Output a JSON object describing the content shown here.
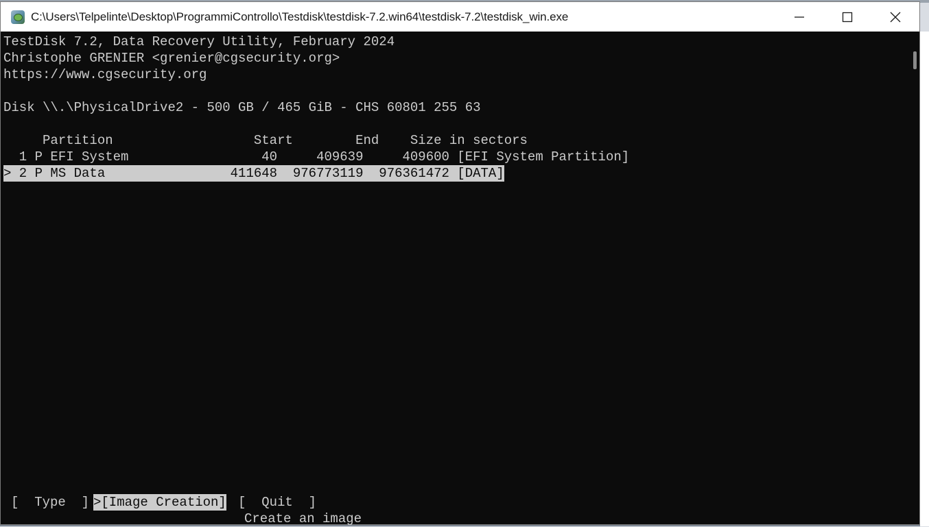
{
  "window": {
    "title": "C:\\Users\\Telpelinte\\Desktop\\ProgrammiControllo\\Testdisk\\testdisk-7.2.win64\\testdisk-7.2\\testdisk_win.exe",
    "app_icon": "testdisk-app-icon",
    "controls": {
      "minimize": "minimize-icon",
      "maximize": "maximize-icon",
      "close": "close-icon"
    }
  },
  "console": {
    "header": [
      "TestDisk 7.2, Data Recovery Utility, February 2024",
      "Christophe GRENIER <grenier@cgsecurity.org>",
      "https://www.cgsecurity.org"
    ],
    "disk_line": "Disk \\\\.\\PhysicalDrive2 - 500 GB / 465 GiB - CHS 60801 255 63",
    "table_header": "     Partition                  Start        End    Size in sectors",
    "partitions": [
      {
        "text": "  1 P EFI System                 40     409639     409600 [EFI System Partition]",
        "selected": false
      },
      {
        "text": "> 2 P MS Data                411648  976773119  976361472 [DATA]",
        "selected": true
      }
    ],
    "menu": {
      "type_option": "[  Type  ]",
      "image_creation_option": ">[Image Creation]",
      "quit_option": "[  Quit  ]",
      "hint": "Create an image"
    }
  }
}
